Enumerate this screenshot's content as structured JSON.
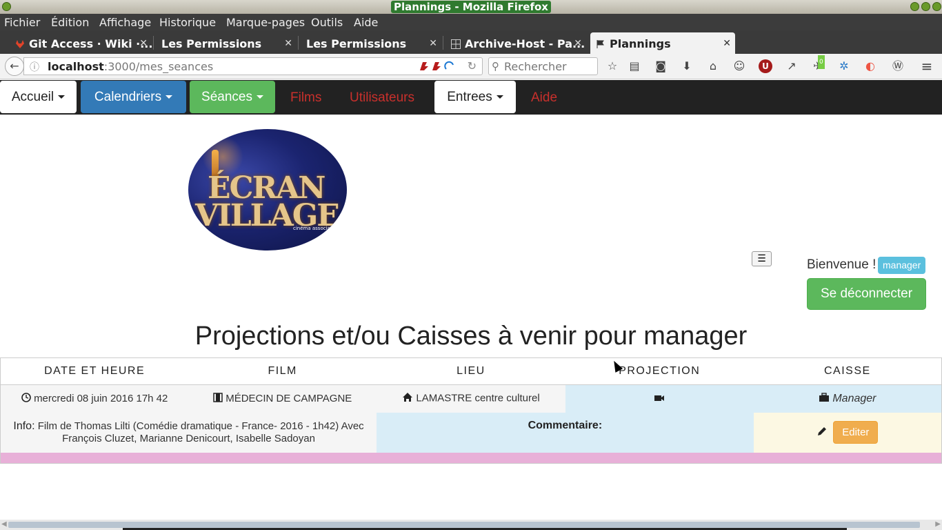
{
  "window": {
    "title": "Plannings - Mozilla Firefox"
  },
  "menubar": [
    "Fichier",
    "Édition",
    "Affichage",
    "Historique",
    "Marque-pages",
    "Outils",
    "Aide"
  ],
  "tabs": [
    {
      "label": "Git Access · Wiki ·...",
      "icon": "gitlab-icon"
    },
    {
      "label": "Les Permissions",
      "icon": ""
    },
    {
      "label": "Les Permissions",
      "icon": ""
    },
    {
      "label": "Archive-Host - Pa...",
      "icon": "grid-icon"
    },
    {
      "label": "Plannings",
      "icon": "flag-icon",
      "active": true
    }
  ],
  "urlbar": {
    "host": "localhost",
    "rest": ":3000/mes_seances"
  },
  "search": {
    "placeholder": "Rechercher"
  },
  "toolbar_badge": "0",
  "appnav": {
    "accueil": "Accueil",
    "calendriers": "Calendriers",
    "seances": "Séances",
    "films": "Films",
    "utilisateurs": "Utilisateurs",
    "entrees": "Entrees",
    "aide": "Aide"
  },
  "logo": {
    "line1": "ÉCRAN",
    "line2": "VILLAGE",
    "tagline": "cinéma associatif"
  },
  "user": {
    "welcome": "Bienvenue !",
    "role": "manager",
    "logout": "Se déconnecter"
  },
  "page_title": "Projections et/ou Caisses à venir pour manager",
  "table": {
    "headers": [
      "DATE ET HEURE",
      "FILM",
      "LIEU",
      "PROJECTION",
      "CAISSE"
    ],
    "row": {
      "date": "mercredi 08 juin 2016 17h 42",
      "film": "MÉDECIN DE CAMPAGNE",
      "lieu": "LAMASTRE centre culturel",
      "caisse": "Manager"
    },
    "info_label": "Info:",
    "info_text": "Film de Thomas Lilti (Comédie dramatique - France- 2016 - 1h42) Avec François Cluzet, Marianne Denicourt, Isabelle Sadoyan",
    "comment_label": "Commentaire:",
    "edit_label": "Editer"
  },
  "colors": {
    "primary": "#337ab7",
    "success": "#5cb85c",
    "danger": "#c9302c",
    "info": "#5bc0de",
    "warning": "#f0ad4e",
    "navbar": "#222222"
  }
}
